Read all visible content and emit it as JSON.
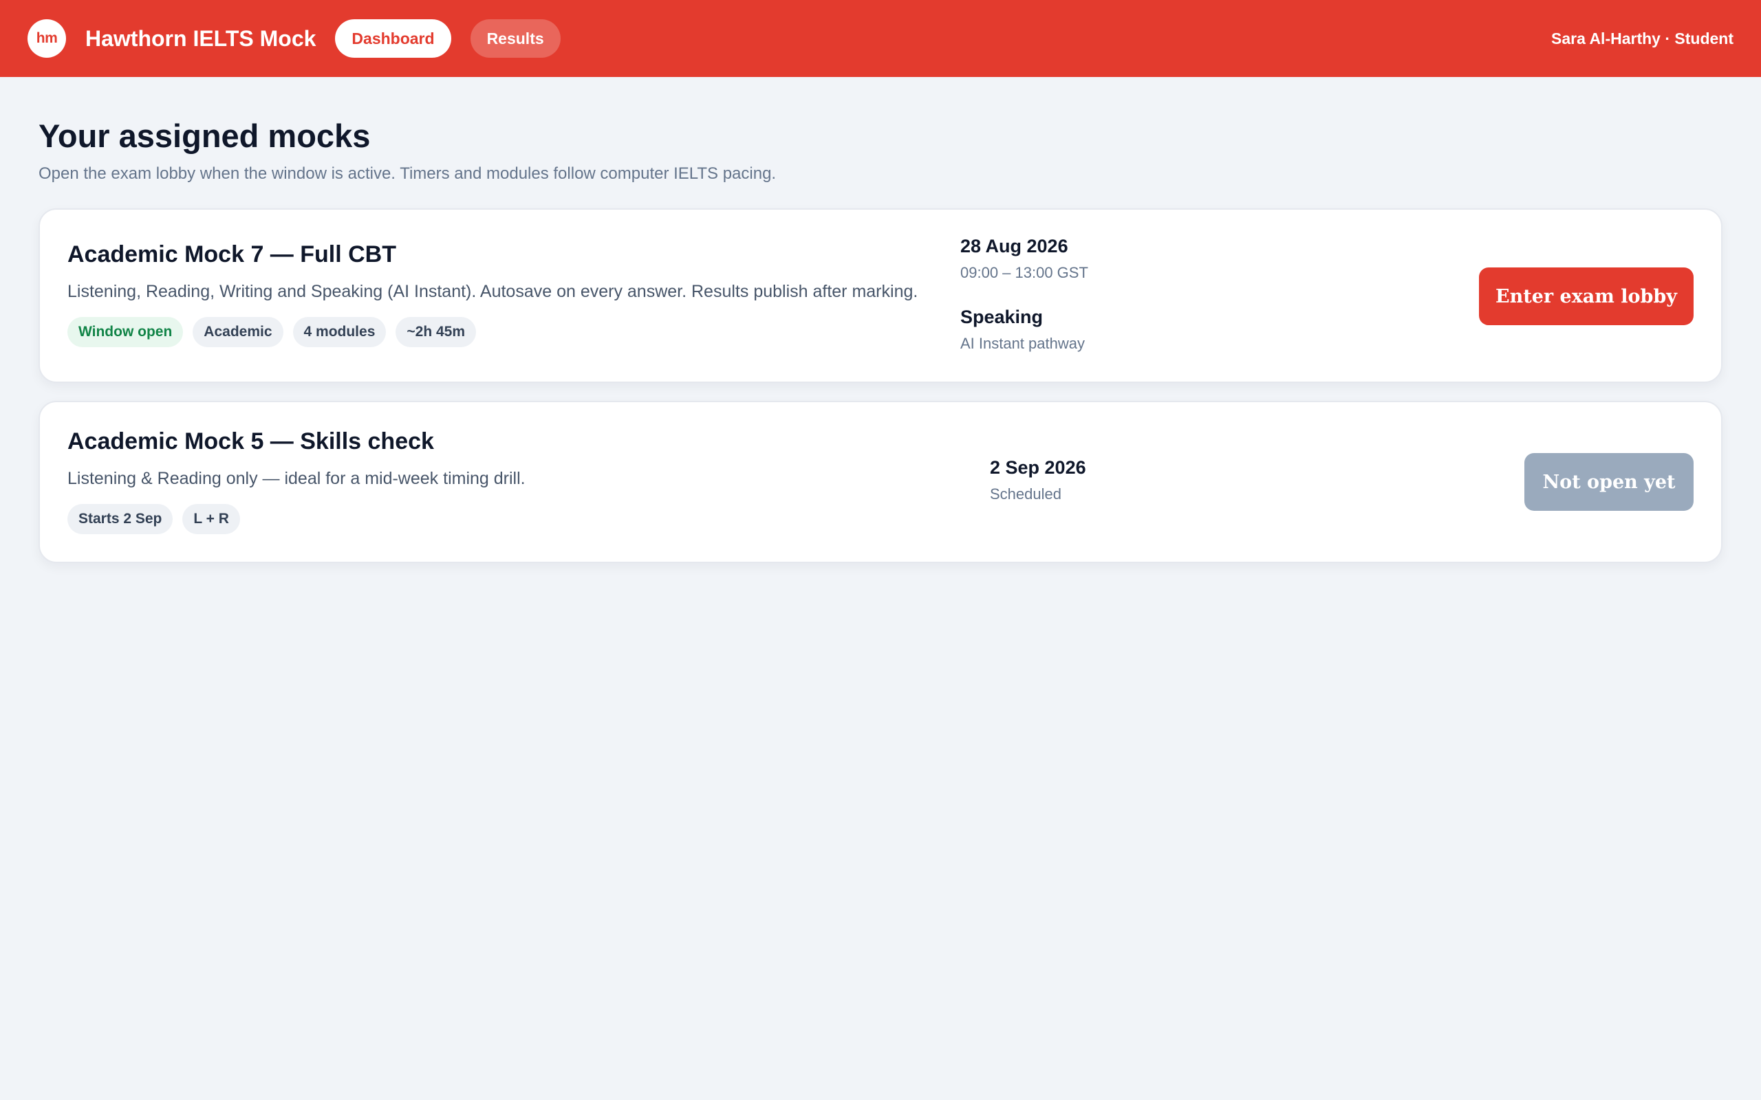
{
  "header": {
    "logo_text": "hm",
    "brand": "Hawthorn IELTS Mock",
    "nav": [
      {
        "label": "Dashboard",
        "active": true
      },
      {
        "label": "Results",
        "active": false
      }
    ],
    "user": "Sara Al-Harthy · Student"
  },
  "page": {
    "title": "Your assigned mocks",
    "subtitle": "Open the exam lobby when the window is active. Timers and modules follow computer IELTS pacing."
  },
  "mocks": [
    {
      "title": "Academic Mock 7 — Full CBT",
      "description": "Listening, Reading, Writing and Speaking (AI Instant). Autosave on every answer. Results publish after marking.",
      "tags": [
        "Window open",
        "Academic",
        "4 modules",
        "~2h 45m"
      ],
      "date": "28 Aug 2026",
      "time": "09:00 – 13:00 GST",
      "extra_label": "Speaking",
      "extra_detail": "AI Instant pathway",
      "action_label": "Enter exam lobby",
      "action_enabled": true
    },
    {
      "title": "Academic Mock 5 — Skills check",
      "description": "Listening & Reading only — ideal for a mid-week timing drill.",
      "tags": [
        "Starts 2 Sep",
        "L + R"
      ],
      "date": "2 Sep 2026",
      "status": "Scheduled",
      "action_label": "Not open yet",
      "action_enabled": false
    }
  ],
  "colors": {
    "brand_red": "#e33b2e",
    "background": "#f1f4f8",
    "open_green": "#118447",
    "disabled_button": "#9aaabd"
  }
}
